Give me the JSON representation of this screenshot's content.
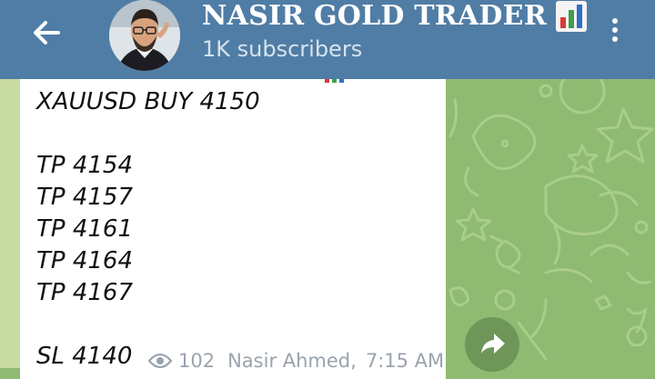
{
  "header": {
    "title": "NASIR GOLD TRADER",
    "subscribers": "1K subscribers",
    "back_icon": "arrow-left-icon",
    "menu_icon": "more-vertical-icon",
    "title_emoji": "bar-chart-icon"
  },
  "message": {
    "lines": [
      "XAUUSD BUY 4150",
      "TP 4154",
      "TP 4157",
      "TP 4161",
      "TP 4164",
      "TP 4167",
      "SL 4140"
    ],
    "views": "102",
    "author": "Nasir Ahmed,",
    "time": "7:15 AM"
  },
  "colors": {
    "header_bg": "#507da5",
    "chat_bg": "#8fba72",
    "bubble_bg": "#ffffff",
    "meta_text": "#9aa3ad"
  },
  "actions": {
    "forward_icon": "forward-arrow-icon"
  }
}
